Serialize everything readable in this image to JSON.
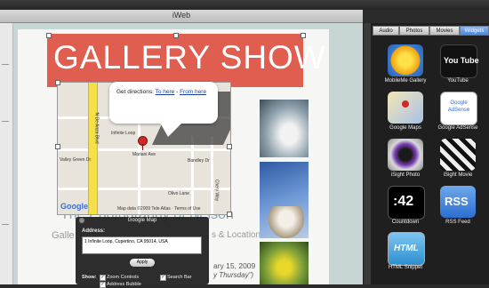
{
  "window": {
    "title": "iWeb"
  },
  "page": {
    "banner_title": "GALLERY SHOW",
    "photographer_text": "The Photography of Nelson",
    "gallery_text": "Galle",
    "location_text": "s & Location",
    "date_text": "ary 15, 2009",
    "thursday_text": "y Thursday\")"
  },
  "map": {
    "bubble_line": "Get directions: ",
    "to_here": "To here",
    "sep": " - ",
    "from_here": "From here",
    "logo": "Google",
    "copyright": "Map data ©2009 Tele Atlas · Terms of Use",
    "streets": [
      "N De Anza Blvd",
      "Infinite Loop",
      "Mariani Ave",
      "Valley Green Dr",
      "Olivo Lane",
      "Chery Way",
      "Bandley Dr"
    ]
  },
  "inspector": {
    "title": "Google Map",
    "address_label": "Address:",
    "address_value": "1 Infinite Loop, Cupertino, CA 95014, USA",
    "apply_label": "Apply",
    "show_label": "Show:",
    "zoom_controls": "Zoom Controls",
    "search_bar": "Search Bar",
    "address_bubble": "Address Bubble"
  },
  "media_panel": {
    "tabs": [
      "Audio",
      "Photos",
      "Movies",
      "Widgets"
    ],
    "selected_tab": "Widgets",
    "widgets": [
      {
        "label": "MobileMe Gallery",
        "icon": "mobileme-gallery-icon"
      },
      {
        "label": "YouTube",
        "icon": "youtube-icon",
        "glyph": "You Tube"
      },
      {
        "label": "Google Maps",
        "icon": "google-maps-icon"
      },
      {
        "label": "Google AdSense",
        "icon": "google-adsense-icon",
        "glyph": "Google AdSense"
      },
      {
        "label": "iSight Photo",
        "icon": "isight-photo-icon"
      },
      {
        "label": "iSight Movie",
        "icon": "isight-movie-icon"
      },
      {
        "label": "Countdown",
        "icon": "countdown-icon",
        "glyph": ":42"
      },
      {
        "label": "RSS Feed",
        "icon": "rss-feed-icon",
        "glyph": "RSS"
      },
      {
        "label": "HTML Snippet",
        "icon": "html-snippet-icon",
        "glyph": "HTML"
      }
    ]
  },
  "colors": {
    "banner": "#e05e4f",
    "selected_tab": "#4d86d6"
  }
}
